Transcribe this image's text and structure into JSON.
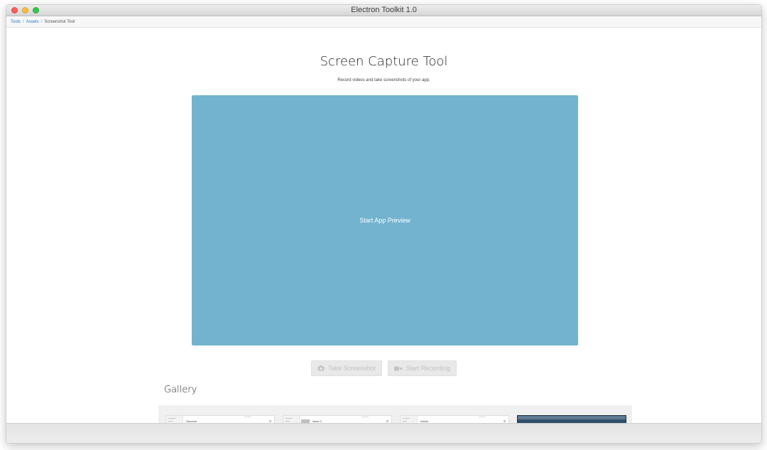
{
  "window": {
    "title": "Electron Toolkit 1.0"
  },
  "breadcrumb": {
    "items": [
      "Tools",
      "Assets",
      "Screenshot Tool"
    ],
    "separator": "/"
  },
  "page": {
    "title": "Screen Capture Tool",
    "subtitle": "Record videos and take screenshots of your app."
  },
  "preview": {
    "label": "Start App Preview",
    "color": "#73b3cf"
  },
  "actions": {
    "screenshot_label": "Take Screenshot",
    "screenshot_icon": "camera-icon",
    "record_label": "Start Recording",
    "record_icon": "video-camera-icon",
    "enabled": false
  },
  "gallery": {
    "title": "Gallery",
    "items": [
      {
        "label": "Discover"
      },
      {
        "label": "Issue 3"
      },
      {
        "label": "Article"
      },
      {
        "label": ""
      }
    ]
  }
}
